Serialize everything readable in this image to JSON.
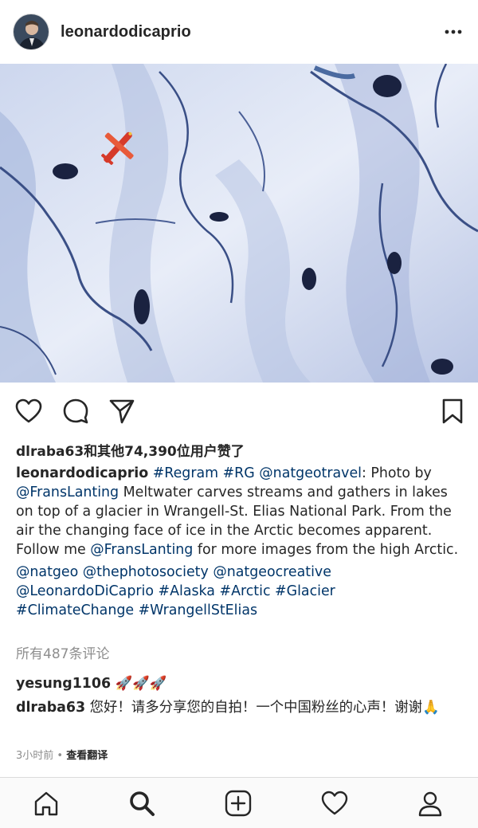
{
  "post": {
    "username": "leonardodicaprio",
    "likes_text": "dlraba63和其他74,390位用户赞了",
    "caption": {
      "author": "leonardodicaprio",
      "tag_regram": "#Regram",
      "tag_rg": "#RG",
      "mention_natgeotravel": "@natgeotravel",
      "text_photo_by": ": Photo by",
      "mention_franslanting": "@FransLanting",
      "text_body": " Meltwater carves streams and gathers in lakes on top of a glacier in Wrangell-St. Elias National Park. From the air the changing face of ice in the Arctic becomes apparent. Follow me ",
      "mention_franslanting2": "@FransLanting",
      "text_end": " for more images from the high Arctic.",
      "tags_line1": "@natgeo @thephotosociety @natgeocreative",
      "tags_line2": "@LeonardoDiCaprio #Alaska #Arctic #Glacier",
      "tags_line3": "#ClimateChange #WrangellStElias"
    },
    "view_all_comments": "所有487条评论",
    "comments": [
      {
        "user": "yesung1106",
        "text": " 🚀🚀🚀"
      },
      {
        "user": "dlraba63",
        "text": " 您好！请多分享您的自拍！一个中国粉丝的心声！谢谢🙏"
      }
    ],
    "time_ago": "3小时前",
    "separator": " • ",
    "translate_label": "查看翻译"
  },
  "icons": {
    "more": "more-horizontal-icon",
    "like": "heart-outline-icon",
    "comment": "comment-bubble-icon",
    "share": "paper-plane-icon",
    "save": "bookmark-icon",
    "nav": [
      "home-icon",
      "search-icon",
      "new-post-icon",
      "activity-heart-icon",
      "profile-icon"
    ]
  },
  "colors": {
    "link": "#003569",
    "text": "#262626",
    "muted": "#8e8e8e",
    "border": "#dbdbdb"
  }
}
